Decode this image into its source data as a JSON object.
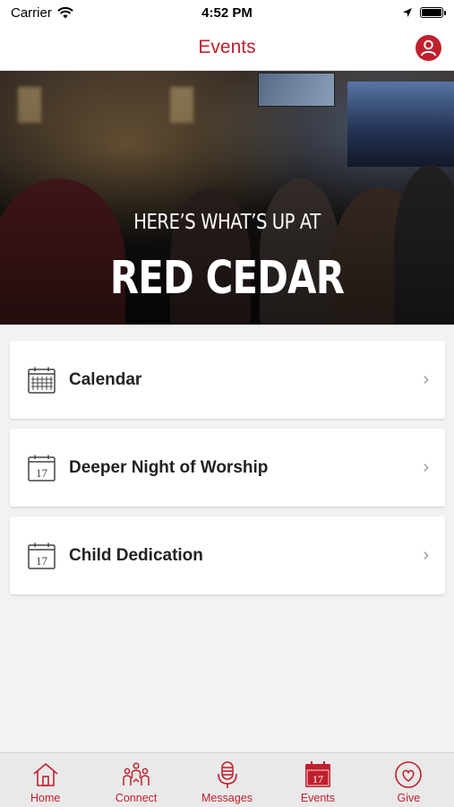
{
  "status_bar": {
    "carrier": "Carrier",
    "time": "4:52 PM"
  },
  "nav": {
    "title": "Events"
  },
  "hero": {
    "subtitle": "HERE’S WHAT’S UP AT",
    "title": "RED CEDAR"
  },
  "cards": [
    {
      "label": "Calendar",
      "icon": "calendar-grid-icon"
    },
    {
      "label": "Deeper Night of Worship",
      "icon": "calendar-date-icon",
      "date": "17"
    },
    {
      "label": "Child Dedication",
      "icon": "calendar-date-icon",
      "date": "17"
    }
  ],
  "tabs": [
    {
      "label": "Home",
      "icon": "home-icon"
    },
    {
      "label": "Connect",
      "icon": "people-icon"
    },
    {
      "label": "Messages",
      "icon": "microphone-icon"
    },
    {
      "label": "Events",
      "icon": "calendar-icon",
      "date": "17",
      "active": true
    },
    {
      "label": "Give",
      "icon": "heart-icon"
    }
  ],
  "colors": {
    "accent": "#c0202e",
    "background": "#f2f2f2"
  }
}
